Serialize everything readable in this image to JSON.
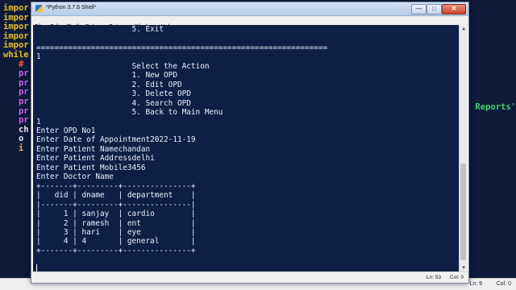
{
  "background_editor": {
    "code_lines": [
      {
        "text": "impor",
        "color": "#e6c11e"
      },
      {
        "text": "impor",
        "color": "#e6c11e"
      },
      {
        "text": "impor",
        "color": "#e6c11e"
      },
      {
        "text": "impor",
        "color": "#e6c11e"
      },
      {
        "text": "impor",
        "color": "#e6c11e"
      },
      {
        "text": "while",
        "color": "#e6c11e"
      },
      {
        "text": "   #",
        "color": "#ff5a3c"
      },
      {
        "text": "   pr",
        "color": "#c85ee6"
      },
      {
        "text": "   pr",
        "color": "#c85ee6"
      },
      {
        "text": "   pr",
        "color": "#c85ee6"
      },
      {
        "text": "   pr",
        "color": "#c85ee6"
      },
      {
        "text": "   pr",
        "color": "#c85ee6"
      },
      {
        "text": "   pr",
        "color": "#c85ee6"
      },
      {
        "text": "   ch",
        "color": "#e8e8e8"
      },
      {
        "text": "   o",
        "color": "#e8e8e8"
      },
      {
        "text": "   i",
        "color": "#e6c11e"
      }
    ],
    "right_text": "Reports'",
    "status": {
      "line": "Ln: 9",
      "col": "Col: 0"
    }
  },
  "window": {
    "title": "*Python 3.7.6 Shell*",
    "controls": {
      "minimize": "—",
      "maximize": "□",
      "close": "✕"
    },
    "menu": [
      "File",
      "Edit",
      "Shell",
      "Debug",
      "Options",
      "Window",
      "Help"
    ]
  },
  "shell": {
    "lines": [
      "                     5. Exit",
      "",
      "================================================================",
      "1",
      "                     Select the Action",
      "                     1. New OPD",
      "                     2. Edit OPD",
      "                     3. Delete OPD",
      "                     4. Search OPD",
      "                     5. Back to Main Menu",
      "1",
      "Enter OPD No1",
      "Enter Date of Appointment2022-11-19",
      "Enter Patient Namechandan",
      "Enter Patient Addressdelhi",
      "Enter Patient Mobile3456",
      "Enter Doctor Name",
      "+-------+---------+---------------+",
      "|   did | dname   | department    |",
      "|-------+---------+---------------|",
      "|     1 | sanjay  | cardio        |",
      "|     2 | ramesh  | ent           |",
      "|     3 | hari    | eye           |",
      "|     4 | 4       | general       |",
      "+-------+---------+---------------+"
    ],
    "status": {
      "line": "Ln: 53",
      "col": "Col: 0"
    }
  }
}
